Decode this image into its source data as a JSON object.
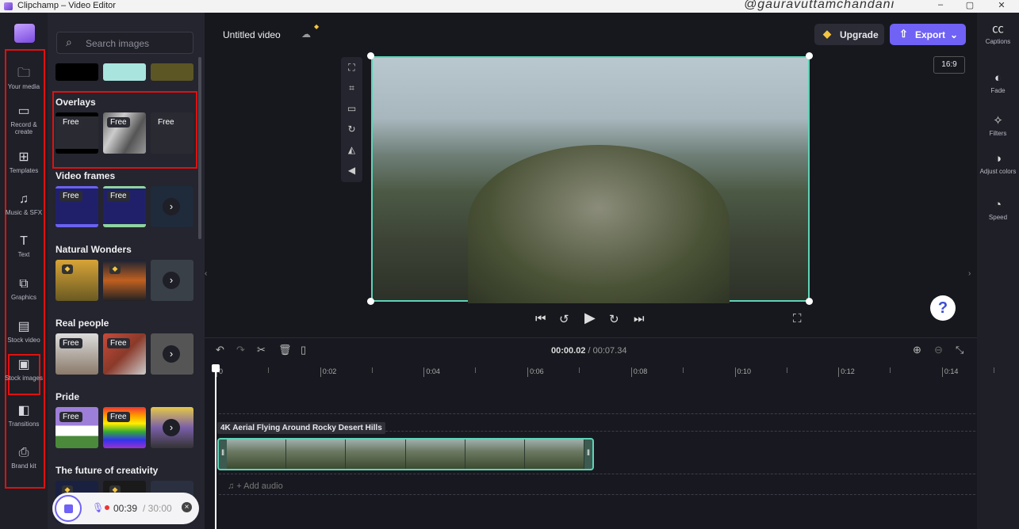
{
  "window": {
    "title": "Clipchamp – Video Editor",
    "watermark": "@gauravuttamchandani",
    "controls": [
      "–",
      "▢",
      "✕"
    ]
  },
  "nav": {
    "items": [
      {
        "label": "Your media",
        "icon": "folder-icon",
        "glyph": "🗀"
      },
      {
        "label": "Record & create",
        "icon": "camera-icon",
        "glyph": "▭"
      },
      {
        "label": "Templates",
        "icon": "templates-icon",
        "glyph": "⊞"
      },
      {
        "label": "Music & SFX",
        "icon": "music-icon",
        "glyph": "♫"
      },
      {
        "label": "Text",
        "icon": "text-icon",
        "glyph": "T"
      },
      {
        "label": "Graphics",
        "icon": "graphics-icon",
        "glyph": "⧉"
      },
      {
        "label": "Stock video",
        "icon": "film-icon",
        "glyph": "▤"
      },
      {
        "label": "Stock images",
        "icon": "image-icon",
        "glyph": "▣"
      },
      {
        "label": "Transitions",
        "icon": "transitions-icon",
        "glyph": "◧"
      },
      {
        "label": "Brand kit",
        "icon": "brand-kit-icon",
        "glyph": "⎙"
      }
    ]
  },
  "panel": {
    "search_placeholder": "Search images",
    "free_label": "Free",
    "sections": [
      "Overlays",
      "Video frames",
      "Natural Wonders",
      "Real people",
      "Pride",
      "The future of creativity"
    ]
  },
  "recorder": {
    "elapsed": "00:39",
    "limit": "/ 30:00"
  },
  "header": {
    "project_title": "Untitled video",
    "upgrade_label": "Upgrade",
    "export_label": "Export",
    "aspect_ratio": "16:9"
  },
  "right": {
    "items": [
      {
        "label": "Captions",
        "glyph": "㏄"
      },
      {
        "label": "Fade",
        "glyph": "◐"
      },
      {
        "label": "Filters",
        "glyph": "✧"
      },
      {
        "label": "Adjust colors",
        "glyph": "◑"
      },
      {
        "label": "Speed",
        "glyph": "◔"
      }
    ]
  },
  "help": "?",
  "timeline": {
    "current_time": "00:00.02",
    "total_time": "/ 00:07.34",
    "ticks": [
      "0",
      "0:02",
      "0:04",
      "0:06",
      "0:08",
      "0:10",
      "0:12",
      "0:14"
    ],
    "clip_title": "4K Aerial Flying Around Rocky Desert Hills",
    "add_audio": "♫ + Add audio"
  }
}
